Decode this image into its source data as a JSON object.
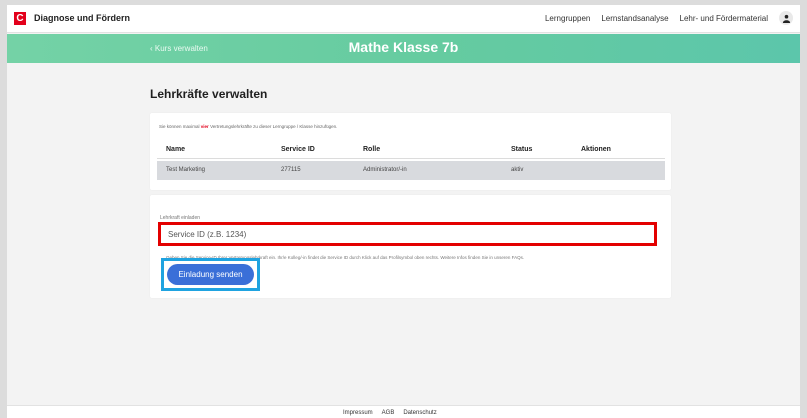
{
  "header": {
    "logo_letter": "C",
    "app_title": "Diagnose und Fördern",
    "nav": [
      "Lerngruppen",
      "Lernstandsanalyse",
      "Lehr- und Fördermaterial"
    ]
  },
  "hero": {
    "back_label": "Kurs verwalten",
    "course_title": "Mathe Klasse 7b",
    "gradient_colors": [
      "#74d2a6",
      "#5cc6ab"
    ]
  },
  "section": {
    "title": "Lehrkräfte verwalten",
    "note_before": "Sie können maximal",
    "note_highlight": "vier",
    "note_after": "Vertretungslehrkräfte zu dieser Lerngruppe / Klasse hinzufügen."
  },
  "table": {
    "columns": [
      "Name",
      "Service ID",
      "Rolle",
      "Status",
      "Aktionen"
    ],
    "rows": [
      [
        "Test Marketing",
        "277115",
        "Administrator/-in",
        "aktiv",
        ""
      ]
    ]
  },
  "invite": {
    "label": "Lehrkraft einladen",
    "placeholder": "Service ID (z.B. 1234)",
    "hint": "Geben Sie die Service-ID Ihrer Vertretungslehrkraft ein. Ihr/e Kolleg/-in findet die Service ID durch Klick auf das Profilsymbol oben rechts. Weitere Infos finden Sie in unseren FAQs.",
    "button_label": "Einladung senden",
    "highlight_color": "#e30000",
    "button_highlight_color": "#1fa3e0"
  },
  "footer": {
    "links": [
      "Impressum",
      "AGB",
      "Datenschutz"
    ]
  },
  "icons": {
    "back": "chevron-left-icon",
    "profile": "user-icon"
  }
}
